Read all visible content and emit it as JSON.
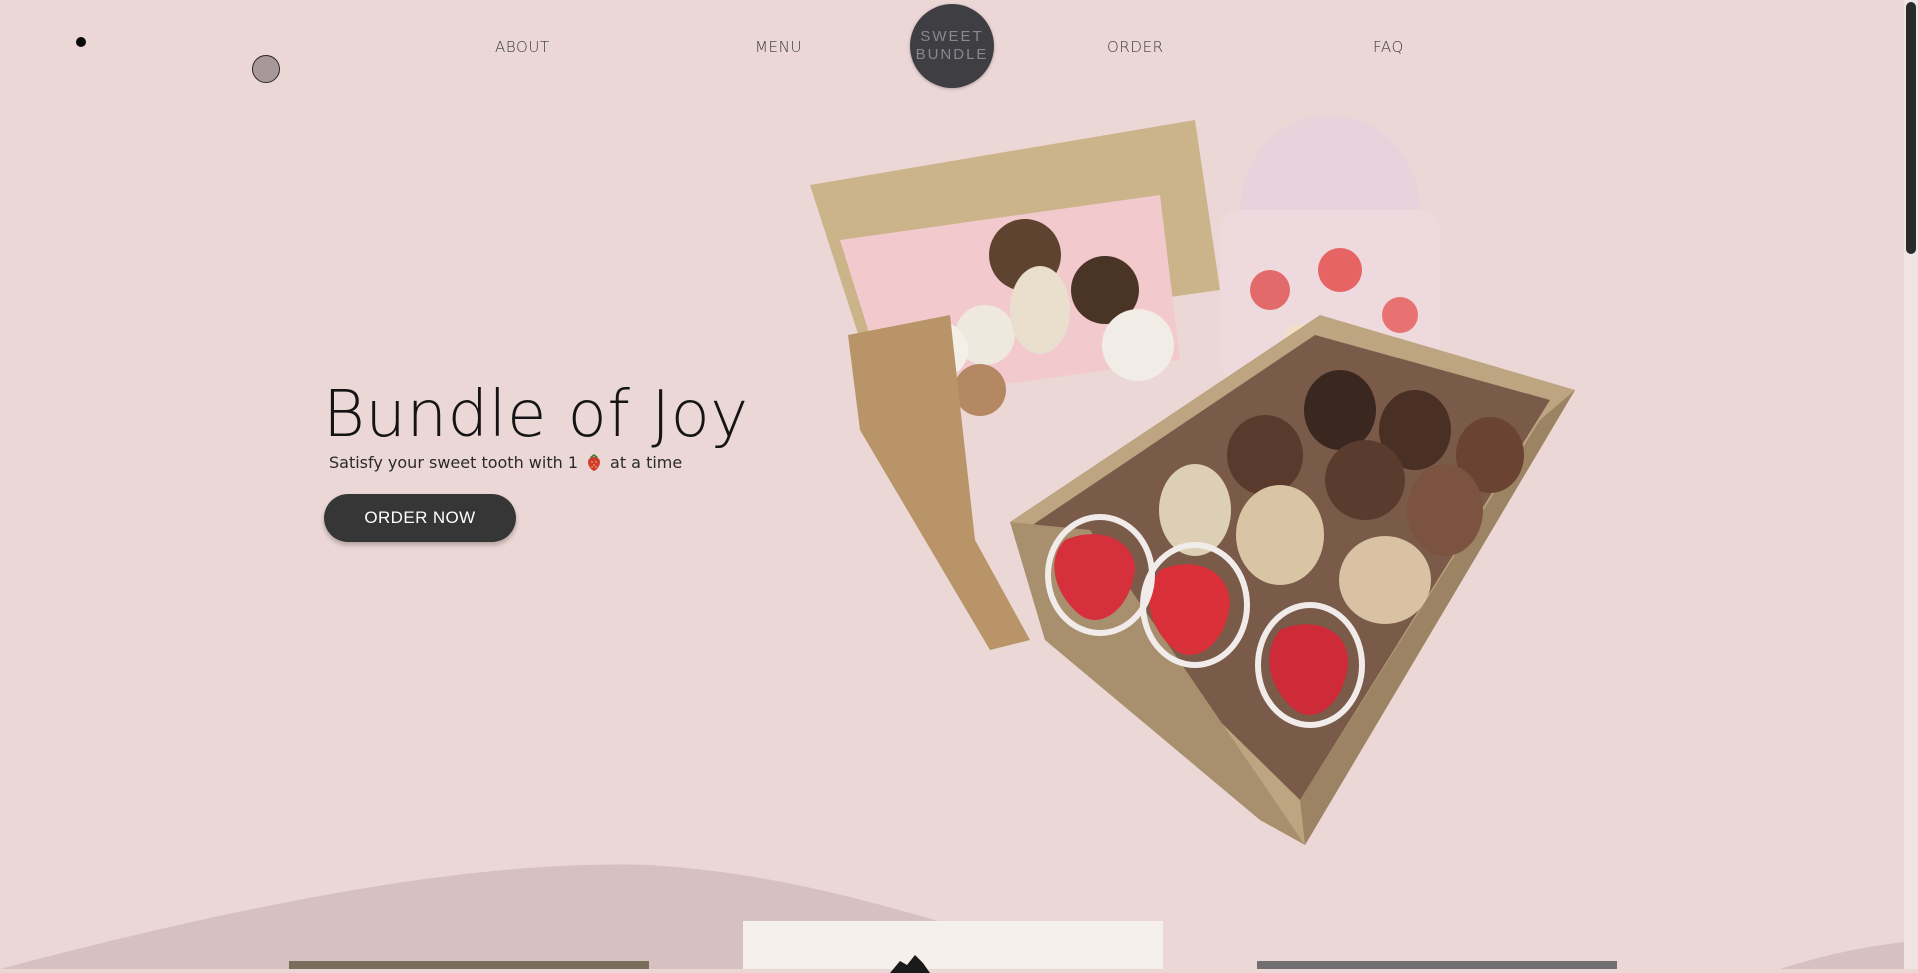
{
  "nav": {
    "links": [
      "ABOUT",
      "MENU",
      "ORDER",
      "FAQ"
    ],
    "logo_line1": "SWEET",
    "logo_line2": "BUNDLE"
  },
  "hero": {
    "title": "Bundle of Joy",
    "subtitle_before": "Satisfy your sweet tooth with 1",
    "subtitle_after": "at a time",
    "cta_label": "ORDER NOW",
    "subtitle_icon": "strawberry-icon"
  },
  "colors": {
    "background": "#ebd7d5",
    "wave": "#d6c1c0",
    "button": "#363636",
    "logo": "#3f3e42"
  }
}
